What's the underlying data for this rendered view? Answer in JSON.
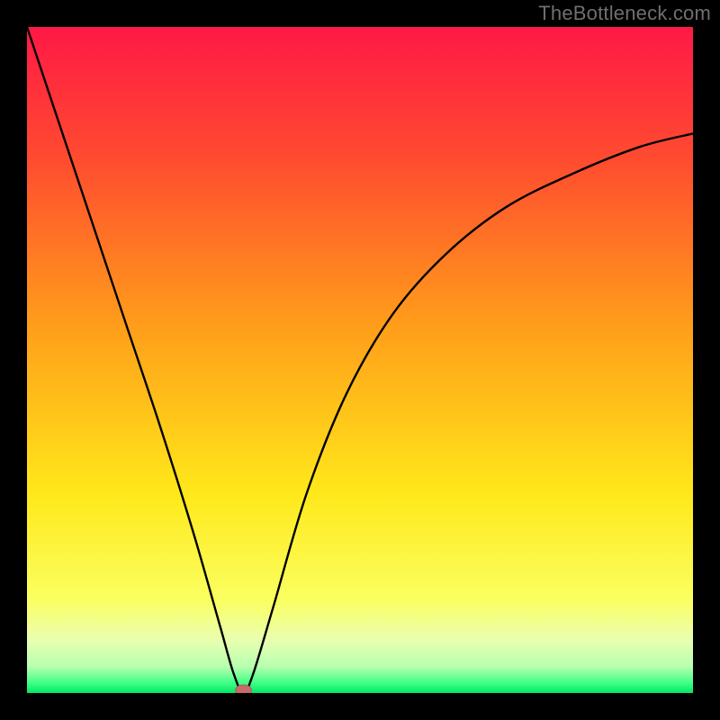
{
  "watermark": "TheBottleneck.com",
  "chart_data": {
    "type": "line",
    "title": "",
    "xlabel": "",
    "ylabel": "",
    "xlim": [
      0,
      1
    ],
    "ylim": [
      0,
      1
    ],
    "series": [
      {
        "name": "bottleneck-curve",
        "x": [
          0.0,
          0.05,
          0.1,
          0.15,
          0.2,
          0.25,
          0.29,
          0.31,
          0.325,
          0.34,
          0.37,
          0.42,
          0.48,
          0.55,
          0.63,
          0.72,
          0.82,
          0.92,
          1.0
        ],
        "y": [
          1.0,
          0.85,
          0.7,
          0.55,
          0.4,
          0.24,
          0.1,
          0.03,
          0.0,
          0.03,
          0.13,
          0.3,
          0.45,
          0.57,
          0.66,
          0.73,
          0.78,
          0.82,
          0.84
        ]
      }
    ],
    "minimum_marker": {
      "x": 0.325,
      "y": 0.0
    },
    "gradient_stops": [
      {
        "offset": 0.0,
        "color": "#ff1846"
      },
      {
        "offset": 0.2,
        "color": "#ff4c2f"
      },
      {
        "offset": 0.45,
        "color": "#ff9e1a"
      },
      {
        "offset": 0.7,
        "color": "#ffe81a"
      },
      {
        "offset": 0.86,
        "color": "#fbff60"
      },
      {
        "offset": 0.92,
        "color": "#e9ffb0"
      },
      {
        "offset": 0.96,
        "color": "#b9ffb0"
      },
      {
        "offset": 0.985,
        "color": "#3fff85"
      },
      {
        "offset": 1.0,
        "color": "#00e865"
      }
    ],
    "marker_fill": "#c76a6a",
    "marker_stroke": "#b35a5a",
    "curve_stroke": "#000000"
  }
}
